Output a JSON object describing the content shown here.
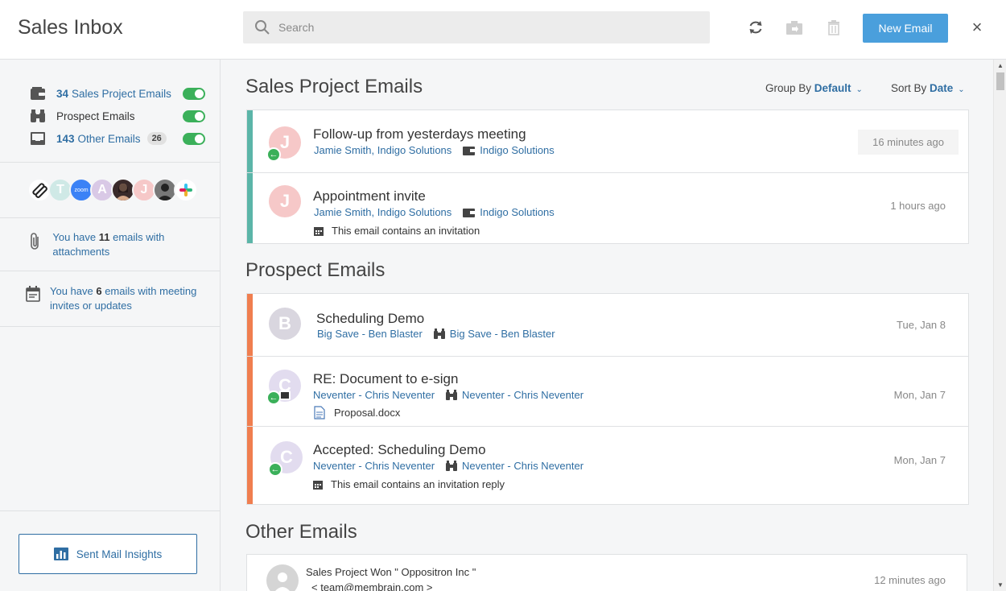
{
  "app_title": "Sales Inbox",
  "search": {
    "placeholder": "Search",
    "value": ""
  },
  "toolbar": {
    "new_email": "New Email",
    "close": "×",
    "icons": [
      "refresh-icon",
      "move-icon",
      "trash-icon",
      "close-icon"
    ]
  },
  "sidebar": {
    "filters": [
      {
        "icon": "wallet-icon",
        "count": "34",
        "label": "Sales Project Emails",
        "badge": "",
        "enabled": true
      },
      {
        "icon": "binoculars-icon",
        "count": "",
        "label": "Prospect Emails",
        "badge": "",
        "enabled": true
      },
      {
        "icon": "inbox-icon",
        "count": "143",
        "label": "Other Emails",
        "badge": "26",
        "enabled": true
      }
    ],
    "avatars": [
      {
        "name": "integration-avatar",
        "text": "",
        "color": "#ffffff"
      },
      {
        "name": "t-avatar",
        "text": "T",
        "color": "#cfe9e6"
      },
      {
        "name": "zoom-avatar",
        "text": "zoom",
        "color": "#3b82f6"
      },
      {
        "name": "a-avatar",
        "text": "A",
        "color": "#d9c9e6"
      },
      {
        "name": "photo-avatar-1",
        "text": "",
        "color": "#3a2a2a"
      },
      {
        "name": "j-avatar",
        "text": "J",
        "color": "#f6c8c8"
      },
      {
        "name": "photo-avatar-2",
        "text": "",
        "color": "#555555"
      },
      {
        "name": "slack-avatar",
        "text": "",
        "color": "#ffffff"
      }
    ],
    "attachments": {
      "pre": "You have ",
      "count": "11",
      "post": " emails with attachments"
    },
    "invites": {
      "pre": "You have ",
      "count": "6",
      "post": " emails with meeting invites or updates"
    },
    "sent_insights": "Sent Mail Insights"
  },
  "main": {
    "group_by": {
      "label": "Group By ",
      "value": "Default"
    },
    "sort_by": {
      "label": "Sort By ",
      "value": "Date"
    },
    "sections": [
      {
        "title": "Sales Project Emails",
        "stripe_color": "#5bb5a8",
        "emails": [
          {
            "initial": "J",
            "avatar_color": "#f6c8c8",
            "reply": true,
            "subject": "Follow-up from yesterdays meeting",
            "contact": "Jamie Smith",
            "company": "Indigo Solutions",
            "project": "Indigo Solutions",
            "note": "",
            "time": "16 minutes ago"
          },
          {
            "initial": "J",
            "avatar_color": "#f6c8c8",
            "reply": false,
            "subject": "Appointment invite",
            "contact": "Jamie Smith",
            "company": "Indigo Solutions",
            "project": "Indigo Solutions",
            "note": "This email contains an invitation",
            "time": "1 hours ago"
          }
        ]
      },
      {
        "title": "Prospect Emails",
        "stripe_color": "#f07e4f",
        "emails": [
          {
            "initial": "B",
            "avatar_color": "#d9d6df",
            "reply": false,
            "subject": "Scheduling Demo",
            "contact": "Big Save - Ben Blaster",
            "prospect": "Big Save - Ben Blaster",
            "note": "",
            "time": "Tue, Jan 8"
          },
          {
            "initial": "C",
            "avatar_color": "#e2dcef",
            "reply": true,
            "subject": "RE: Document to e-sign",
            "contact_company": "Neventer - ",
            "contact": "Chris Neventer",
            "prospect_company": "Neventer - ",
            "prospect": "Chris Neventer",
            "attachment": "Proposal.docx",
            "time": "Mon, Jan 7"
          },
          {
            "initial": "C",
            "avatar_color": "#e2dcef",
            "reply": true,
            "subject": "Accepted: Scheduling Demo",
            "contact_company": "Neventer - ",
            "contact": "Chris Neventer",
            "prospect_company": "Neventer - ",
            "prospect": "Chris Neventer",
            "note": "This email contains an invitation reply",
            "time": "Mon, Jan 7"
          }
        ]
      },
      {
        "title": "Other Emails",
        "emails": [
          {
            "subject": "Sales Project Won \" Oppositron Inc \"",
            "from": "< team@membrain.com >",
            "time": "12 minutes ago"
          }
        ]
      }
    ]
  },
  "colors": {
    "accent": "#4a9fdc",
    "link": "#2f6ea3",
    "toggle_on": "#3bb05a",
    "reply": "#3bb05a"
  }
}
